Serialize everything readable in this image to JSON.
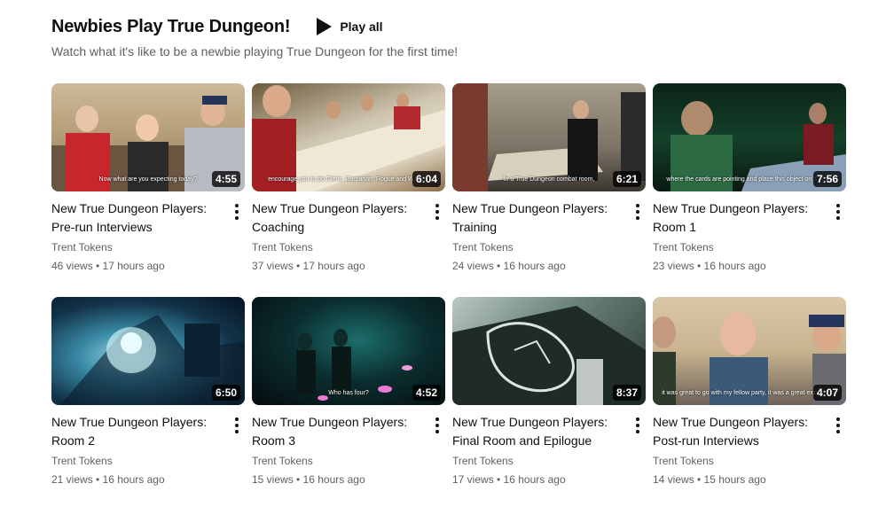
{
  "shelf": {
    "title": "Newbies Play True Dungeon!",
    "play_all_label": "Play all",
    "description": "Watch what it's like to be a newbie playing True Dungeon for the first time!"
  },
  "videos": [
    {
      "title": "New True Dungeon Players: Pre-run Interviews",
      "channel": "Trent Tokens",
      "stats": "46 views • 17 hours ago",
      "duration": "4:55",
      "caption": "Now what are you expecting today?"
    },
    {
      "title": "New True Dungeon Players: Coaching",
      "channel": "Trent Tokens",
      "stats": "37 views • 17 hours ago",
      "duration": "6:04",
      "caption": "encourage you to do Cleric, Barbarian, Rogue and Wizard."
    },
    {
      "title": "New True Dungeon Players: Training",
      "channel": "Trent Tokens",
      "stats": "24 views • 16 hours ago",
      "duration": "6:21",
      "caption": "In a True Dungeon combat room,"
    },
    {
      "title": "New True Dungeon Players: Room 1",
      "channel": "Trent Tokens",
      "stats": "23 views • 16 hours ago",
      "duration": "7:56",
      "caption": "where the cards are pointing and place this object on a card."
    },
    {
      "title": "New True Dungeon Players: Room 2",
      "channel": "Trent Tokens",
      "stats": "21 views • 16 hours ago",
      "duration": "6:50",
      "caption": ""
    },
    {
      "title": "New True Dungeon Players: Room 3",
      "channel": "Trent Tokens",
      "stats": "15 views • 16 hours ago",
      "duration": "4:52",
      "caption": "Who has four?"
    },
    {
      "title": "New True Dungeon Players: Final Room and Epilogue",
      "channel": "Trent Tokens",
      "stats": "17 views • 16 hours ago",
      "duration": "8:37",
      "caption": ""
    },
    {
      "title": "New True Dungeon Players: Post-run Interviews",
      "channel": "Trent Tokens",
      "stats": "14 views • 15 hours ago",
      "duration": "4:07",
      "caption": "it was great to go with my fellow party, it was a great experience"
    }
  ]
}
